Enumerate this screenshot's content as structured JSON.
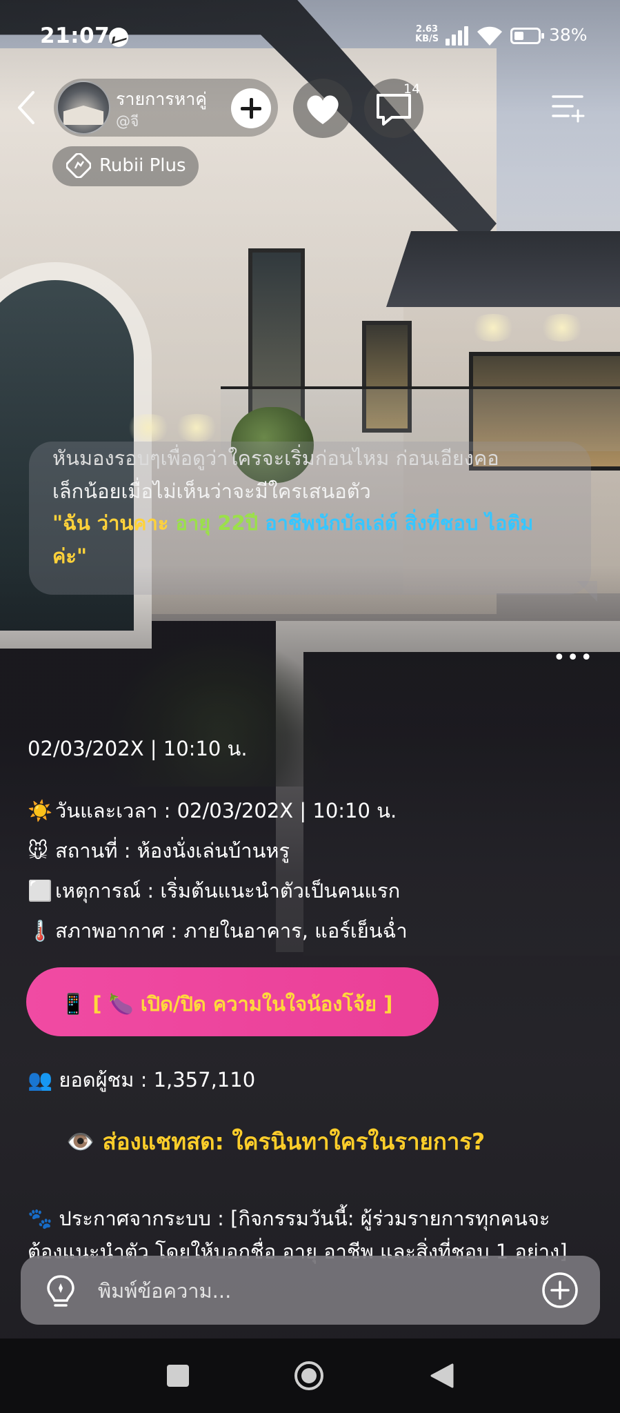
{
  "status_bar": {
    "time": "21:07",
    "net_speed_value": "2.63",
    "net_speed_unit": "KB/S",
    "battery": "38%",
    "battery_level": 0.38,
    "icons": [
      "messenger-icon",
      "signal-icon",
      "wifi-icon",
      "battery-icon"
    ]
  },
  "header": {
    "show_title": "รายการหาคู่",
    "handle": "@จี",
    "comment_count": "14",
    "badge_label": "Rubii Plus",
    "icons": [
      "back-icon",
      "plus-icon",
      "heart-icon",
      "comment-icon",
      "menu-icon",
      "rubii-icon"
    ]
  },
  "narration": {
    "line1": "หันมองรอบๆเพื่อดูว่าใครจะเริ่มก่อนไหม ก่อนเอียงคอ",
    "line2": "เล็กน้อยเมื่อไม่เห็นว่าจะมีใครเสนอตัว",
    "quote_part1": "\"ฉัน ว่านคาะ",
    "quote_part2": " อายุ 22ปี",
    "quote_part3": " อาชีพนักบัลเล่ต์ สิ่งที่ชอบ ไอติม",
    "quote_part4": "ค่ะ\"",
    "more": "•••"
  },
  "info": {
    "datetime_header": "02/03/202X | 10:10 น.",
    "rows": [
      {
        "emoji": "☀️",
        "text": "วันและเวลา : 02/03/202X | 10:10 น."
      },
      {
        "emoji": "🐭",
        "text": "สถานที่ : ห้องนั่งเล่นบ้านหรู"
      },
      {
        "emoji": "⬜",
        "text": "เหตุการณ์ : เริ่มต้นแนะนำตัวเป็นคนแรก"
      },
      {
        "emoji": "🌡️",
        "text": "สภาพอากาศ : ภายในอาคาร, แอร์เย็นฉ่ำ"
      }
    ],
    "cta_label": "📱 [ 🍆 เปิด/ปิด ความในใจน้องโจ้ย ]",
    "viewers": "👥 ยอดผู้ชม : 1,357,110",
    "spy_chat": "👁️ ส่องแชทสด: ใครนินทาใครในรายการ?",
    "announce_line1": "🐾 ประกาศจากระบบ : [กิจกรรมวันนี้: ผู้ร่วมรายการทุกคนจะ",
    "announce_line2": "ต้องแนะนำตัว โดยให้บอกชื่อ อายุ อาชีพ และสิ่งที่ชอบ 1 อย่าง]"
  },
  "composer": {
    "placeholder": "พิมพ์ข้อความ...",
    "icons": [
      "lightbulb-icon",
      "add-circle-icon"
    ]
  },
  "nav": {
    "icons": [
      "recent-apps-icon",
      "home-icon",
      "back-triangle-icon"
    ]
  }
}
